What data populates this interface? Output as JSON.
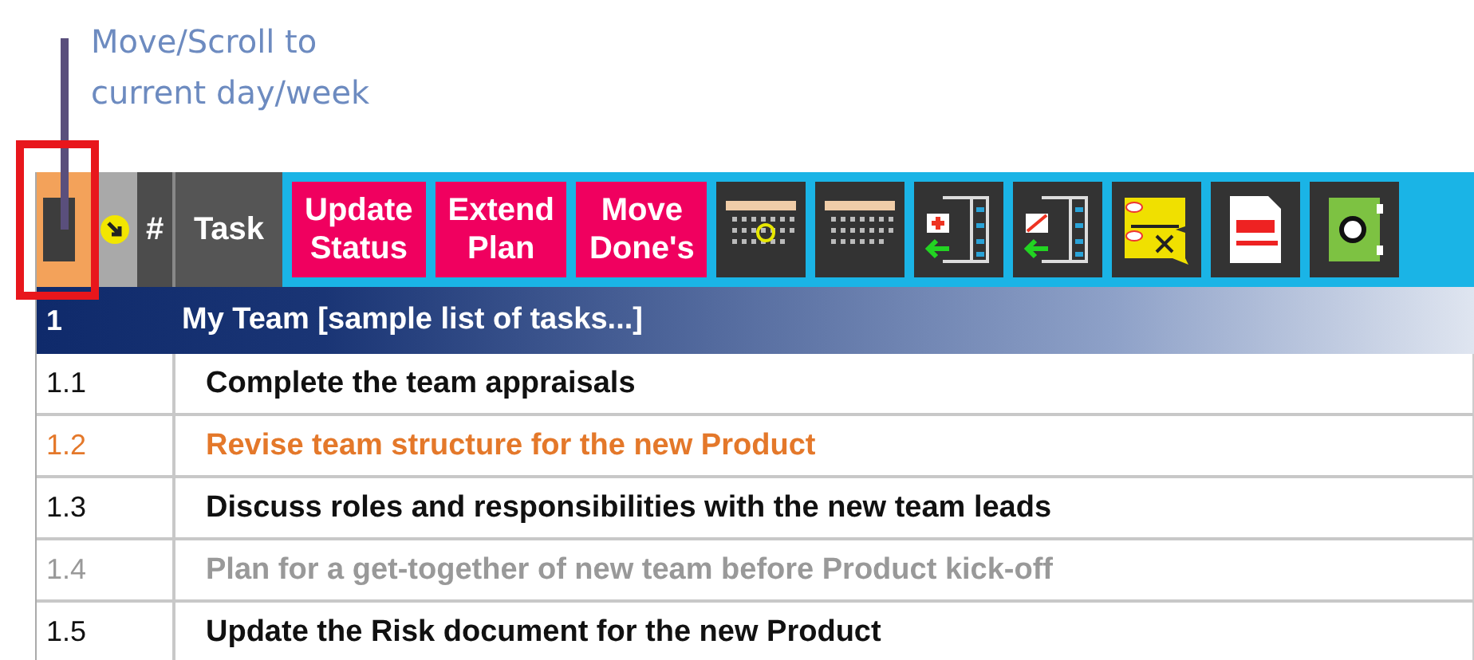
{
  "callout": {
    "lines": [
      "Move/Scroll  to",
      "current day/week"
    ]
  },
  "header": {
    "number_column": "#",
    "task_column": "Task"
  },
  "action_buttons": [
    {
      "label": "Update\nStatus"
    },
    {
      "label": "Extend\nPlan"
    },
    {
      "label": "Move\nDone's"
    }
  ],
  "tool_icons": [
    {
      "kind": "calendar-today"
    },
    {
      "kind": "calendar"
    },
    {
      "kind": "add-row"
    },
    {
      "kind": "move-row"
    },
    {
      "kind": "delete-note"
    },
    {
      "kind": "pdf"
    },
    {
      "kind": "camera"
    }
  ],
  "group": {
    "number": "1",
    "title": "My Team [sample list of tasks...]"
  },
  "tasks": [
    {
      "number": "1.1",
      "title": "Complete the team appraisals",
      "color": "#111111"
    },
    {
      "number": "1.2",
      "title": "Revise team structure for the new Product",
      "color": "#e4782a"
    },
    {
      "number": "1.3",
      "title": "Discuss roles and responsibilities with the new team leads",
      "color": "#111111"
    },
    {
      "number": "1.4",
      "title": "Plan for a get-together of new team before Product kick-off",
      "color": "#999999"
    },
    {
      "number": "1.5",
      "title": "Update the Risk document for the new Product",
      "color": "#111111"
    }
  ]
}
